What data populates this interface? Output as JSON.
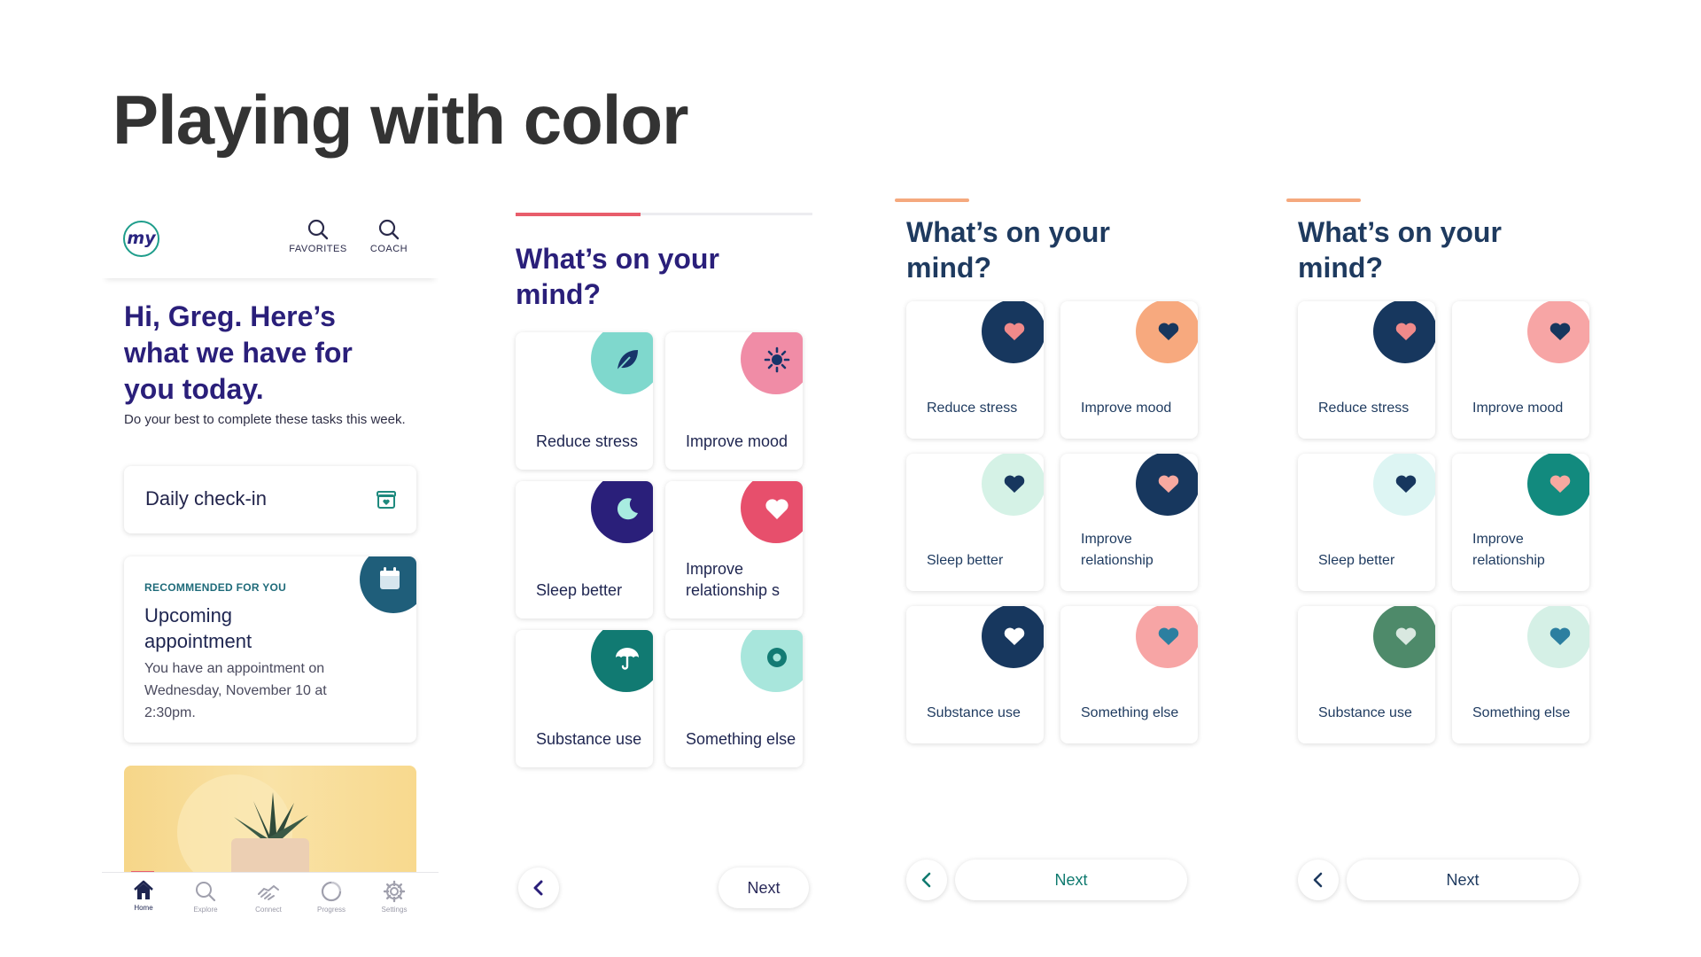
{
  "slide": {
    "title": "Playing with color"
  },
  "screen1": {
    "logo_text": "my",
    "header_buttons": [
      {
        "label": "FAVORITES",
        "icon": "search-icon"
      },
      {
        "label": "COACH",
        "icon": "search-icon"
      }
    ],
    "greeting": "Hi, Greg. Here’s what we have for you today.",
    "subtitle": "Do your best to complete these tasks this week.",
    "checkin": {
      "label": "Daily check-in",
      "icon": "box-heart-icon"
    },
    "recommended": {
      "eyebrow": "RECOMMENDED FOR YOU",
      "title": "Upcoming appointment",
      "body": "You have an appointment on Wednesday, November 10 at 2:30pm.",
      "icon": "calendar-icon",
      "badge_color": "#1f5e7a"
    },
    "nav": [
      {
        "label": "Home",
        "icon": "home-icon",
        "active": true
      },
      {
        "label": "Explore",
        "icon": "search-icon",
        "active": false
      },
      {
        "label": "Connect",
        "icon": "handshake-icon",
        "active": false
      },
      {
        "label": "Progress",
        "icon": "progress-ring-icon",
        "active": false
      },
      {
        "label": "Settings",
        "icon": "gear-icon",
        "active": false
      }
    ],
    "nav_active_color": "#e85d6b"
  },
  "screen2": {
    "progress": 0.42,
    "progress_color": "#e85d6b",
    "title": "What’s on your mind?",
    "cards": [
      {
        "label": "Reduce stress",
        "icon": "leaf-icon",
        "blob_color": "#7fd8cd",
        "icon_color": "#17356a"
      },
      {
        "label": "Improve mood",
        "icon": "sun-icon",
        "blob_color": "#f08ca6",
        "icon_color": "#17356a"
      },
      {
        "label": "Sleep better",
        "icon": "moon-icon",
        "blob_color": "#2a1f7a",
        "icon_color": "#a8ece0"
      },
      {
        "label": "Improve relationship s",
        "icon": "heart-icon",
        "blob_color": "#e74f6c",
        "icon_color": "#ffffff"
      },
      {
        "label": "Substance use",
        "icon": "umbrella-icon",
        "blob_color": "#117a72",
        "icon_color": "#ffffff"
      },
      {
        "label": "Something else",
        "icon": "dot-icon",
        "blob_color": "#a8e6dc",
        "icon_color": "#137b74"
      }
    ],
    "back_icon": "chevron-left-icon",
    "next_label": "Next",
    "accent": "#2a1f7a"
  },
  "screen3": {
    "title": "What’s on your mind?",
    "progress_color": "#f5a97e",
    "cards": [
      {
        "label": "Reduce stress",
        "icon": "heart-icon",
        "blob_color": "#17375e",
        "icon_color": "#f08a8a"
      },
      {
        "label": "Improve mood",
        "icon": "heart-icon",
        "blob_color": "#f7a97e",
        "icon_color": "#17375e"
      },
      {
        "label": "Sleep better",
        "icon": "heart-icon",
        "blob_color": "#d5f2e6",
        "icon_color": "#17375e"
      },
      {
        "label": "Improve relationship",
        "icon": "heart-icon",
        "blob_color": "#17375e",
        "icon_color": "#f7a9a0"
      },
      {
        "label": "Substance use",
        "icon": "heart-icon",
        "blob_color": "#17375e",
        "icon_color": "#ffffff"
      },
      {
        "label": "Something else",
        "icon": "heart-icon",
        "blob_color": "#f7a5a5",
        "icon_color": "#2c7fa0"
      }
    ],
    "back_icon": "chevron-left-icon",
    "next_label": "Next",
    "accent": "#0f7a6f"
  },
  "screen4": {
    "title": "What’s on your mind?",
    "progress_color": "#f5a97e",
    "cards": [
      {
        "label": "Reduce stress",
        "icon": "heart-icon",
        "blob_color": "#17375e",
        "icon_color": "#f08a8a"
      },
      {
        "label": "Improve mood",
        "icon": "heart-icon",
        "blob_color": "#f7a5a5",
        "icon_color": "#17375e"
      },
      {
        "label": "Sleep better",
        "icon": "heart-icon",
        "blob_color": "#ddf5f3",
        "icon_color": "#17375e"
      },
      {
        "label": "Improve relationship",
        "icon": "heart-icon",
        "blob_color": "#128a7e",
        "icon_color": "#f7a9a0"
      },
      {
        "label": "Substance use",
        "icon": "heart-icon",
        "blob_color": "#4e8a6a",
        "icon_color": "#d9e8e0"
      },
      {
        "label": "Something else",
        "icon": "heart-icon",
        "blob_color": "#d5f0e6",
        "icon_color": "#2c7fa0"
      }
    ],
    "back_icon": "chevron-left-icon",
    "next_label": "Next",
    "accent": "#1e3a5f"
  }
}
